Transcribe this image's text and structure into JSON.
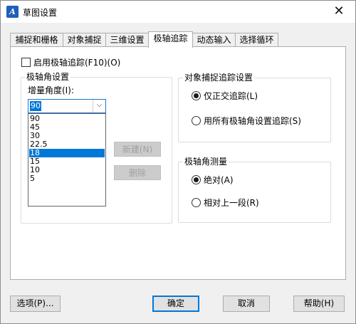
{
  "window": {
    "title": "草图设置",
    "close_glyph": "✕",
    "app_icon": "drawing-settings-icon"
  },
  "tabs": [
    {
      "label": "捕捉和栅格",
      "active": false
    },
    {
      "label": "对象捕捉",
      "active": false
    },
    {
      "label": "三维设置",
      "active": false
    },
    {
      "label": "极轴追踪",
      "active": true
    },
    {
      "label": "动态输入",
      "active": false
    },
    {
      "label": "选择循环",
      "active": false
    }
  ],
  "polar": {
    "enable_label": "启用极轴追踪(F10)(O)",
    "enabled": false,
    "angle_group_title": "极轴角设置",
    "increment_label": "增量角度(I):",
    "increment_value": "90",
    "increment_options": [
      "90",
      "45",
      "30",
      "22.5",
      "18",
      "15",
      "10",
      "5"
    ],
    "highlighted_option": "18",
    "new_button": "新建(N)",
    "delete_button": "删除"
  },
  "snap_tracking": {
    "title": "对象捕捉追踪设置",
    "option_orthogonal": "仅正交追踪(L)",
    "option_all": "用所有极轴角设置追踪(S)",
    "selected": "orthogonal"
  },
  "measure": {
    "title": "极轴角测量",
    "option_absolute": "绝对(A)",
    "option_relative": "相对上一段(R)",
    "selected": "absolute"
  },
  "footer": {
    "options_button": "选项(P)...",
    "ok_button": "确定",
    "cancel_button": "取消",
    "help_button": "帮助(H)"
  }
}
